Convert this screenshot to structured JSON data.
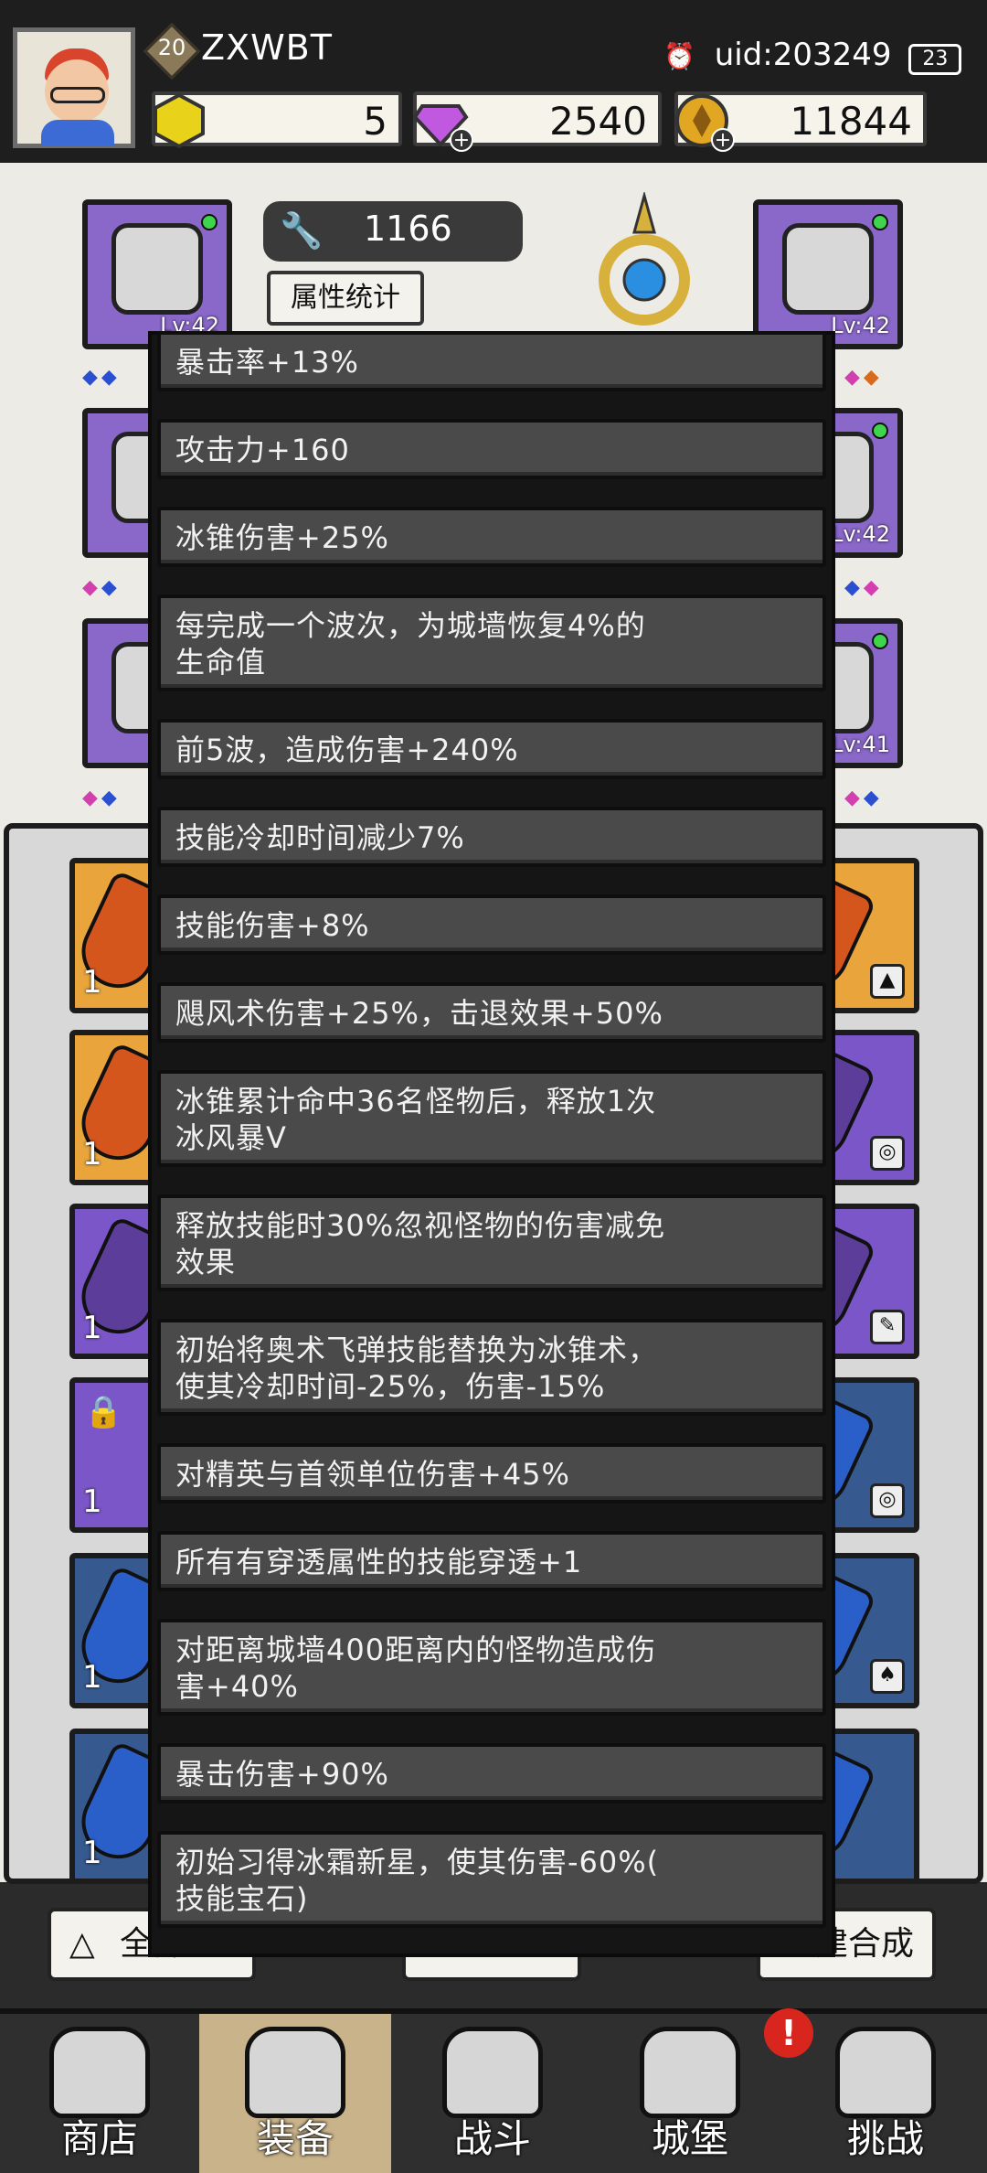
{
  "player": {
    "level": "20",
    "name": "ZXWBT",
    "avatar_icon": "cartoon-boy-avatar"
  },
  "status_bar": {
    "uid": "uid:203249",
    "battery": "23"
  },
  "resources": {
    "energy": "5",
    "gems": "2540",
    "gold": "11844"
  },
  "equipment": {
    "power": "1166",
    "stats_button": "属性统计",
    "slots": [
      {
        "level": "Lv:42",
        "icon": "hood-icon"
      },
      {
        "level": "Lv:42",
        "icon": "gauntlet-icon"
      },
      {
        "level": "Lv:42",
        "icon": "ring-icon"
      },
      {
        "level": "Lv:41",
        "icon": "amulet-icon"
      }
    ]
  },
  "tooltip": {
    "stats": [
      "暴击率+13%",
      "攻击力+160",
      "冰锥伤害+25%",
      "每完成一个波次，为城墙恢复4%的\n生命值",
      "前5波，造成伤害+240%",
      "技能冷却时间减少7%",
      "技能伤害+8%",
      "飓风术伤害+25%，击退效果+50%",
      "冰锥累计命中36名怪物后，释放1次\n冰风暴V",
      "释放技能时30%忽视怪物的伤害减免\n效果",
      "初始将奥术飞弹技能替换为冰锥术，\n使其冷却时间-25%，伤害-15%",
      "对精英与首领单位伤害+45%",
      "所有有穿透属性的技能穿透+1",
      "对距离城墙400距离内的怪物造成伤\n害+40%",
      "暴击伤害+90%",
      "初始习得冰霜新星，使其伤害-60%(\n技能宝石)"
    ]
  },
  "inventory": {
    "quantity": "1"
  },
  "filters": {
    "all": "全部",
    "merge": "建合成"
  },
  "nav": {
    "shop": "商店",
    "equip": "装备",
    "battle": "战斗",
    "castle": "城堡",
    "challenge": "挑战",
    "alert": "!"
  }
}
